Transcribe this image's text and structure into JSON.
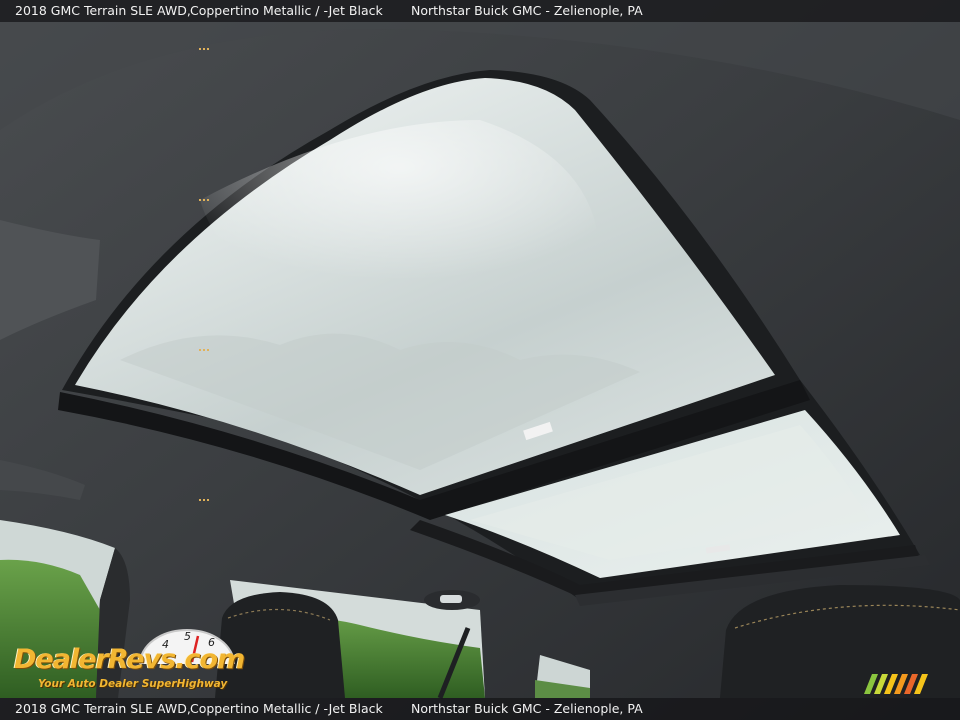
{
  "caption": {
    "model": "2018 GMC Terrain SLE AWD,",
    "color": "Coppertino Metallic / -Jet Black",
    "dealer": "Northstar Buick GMC - Zelienople, PA"
  },
  "watermark": {
    "logo_text": "DealerRevs.com",
    "tagline": "Your Auto Dealer SuperHighway",
    "gauge_numbers": [
      "4",
      "5",
      "6"
    ]
  },
  "colors": {
    "headliner": "#3a3d40",
    "sky": "#dfe6e4",
    "foliage": "#4f8a3a",
    "logo_gold": "#f2b632"
  }
}
